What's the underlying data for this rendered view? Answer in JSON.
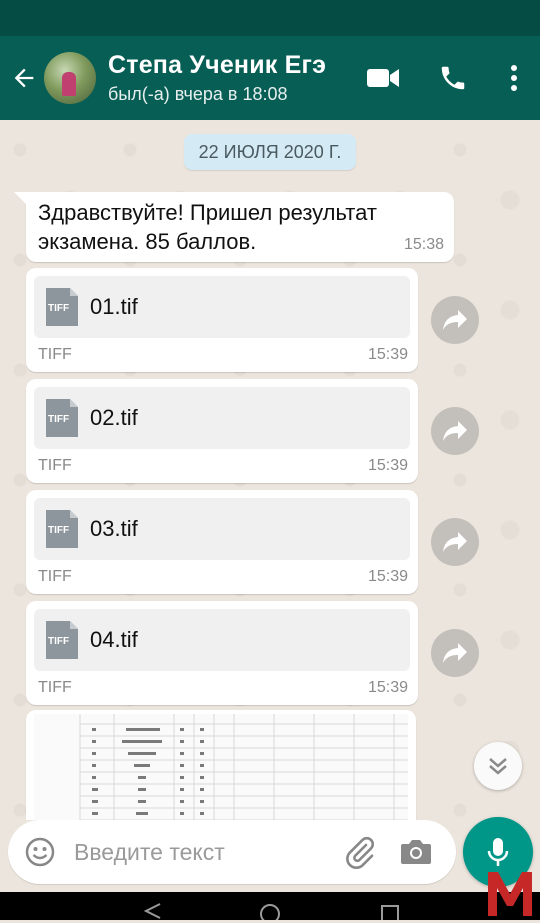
{
  "header": {
    "contact_name": "Степа Ученик Егэ",
    "contact_status": "был(-а) вчера в 18:08",
    "actions": [
      "video-call-icon",
      "phone-icon",
      "more-vert-icon"
    ],
    "accent_color": "#075e54"
  },
  "chat": {
    "date_chip": "22 ИЮЛЯ 2020 Г.",
    "text_message": {
      "text": "Здравствуйте! Пришел результат экзамена. 85 баллов.",
      "time": "15:38"
    },
    "files": [
      {
        "icon_label": "TIFF",
        "name": "01.tif",
        "type": "TIFF",
        "time": "15:39"
      },
      {
        "icon_label": "TIFF",
        "name": "02.tif",
        "type": "TIFF",
        "time": "15:39"
      },
      {
        "icon_label": "TIFF",
        "name": "03.tif",
        "type": "TIFF",
        "time": "15:39"
      },
      {
        "icon_label": "TIFF",
        "name": "04.tif",
        "type": "TIFF",
        "time": "15:39"
      }
    ]
  },
  "composer": {
    "placeholder": "Введите текст",
    "value": ""
  },
  "watermark_letter": "M"
}
